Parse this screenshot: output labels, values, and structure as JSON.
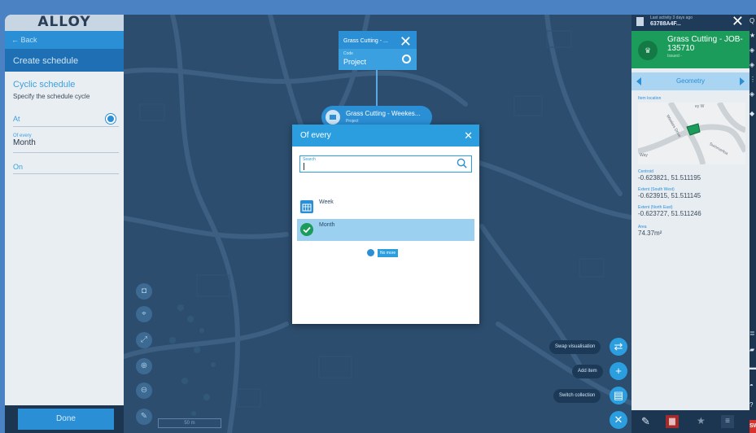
{
  "app": {
    "logo": "ALLOY"
  },
  "left_panel": {
    "back_label": "Back",
    "header": "Create schedule",
    "section_title": "Cyclic schedule",
    "section_subtitle": "Specify the schedule cycle",
    "field_at": "At",
    "field_every_label": "Of every",
    "field_every_value": "Month",
    "field_on": "On",
    "done_label": "Done"
  },
  "nodes": {
    "top_title": "Grass Cutting - ...",
    "top_code_label": "Code",
    "top_code_value": "Project",
    "mid_title": "Grass Cutting - Weekes...",
    "mid_sub": "Project"
  },
  "dialog": {
    "title": "Of every",
    "search_label": "Search",
    "search_value": "",
    "options": [
      {
        "label": "Week",
        "selected": false,
        "icon": "calendar-icon"
      },
      {
        "label": "Month",
        "selected": true,
        "icon": "check-circle-icon"
      }
    ],
    "end_label": "No more"
  },
  "map": {
    "scale_label": "50 m",
    "actions": [
      {
        "label": "Swap visualisation",
        "icon": "swap-icon"
      },
      {
        "label": "Add item",
        "icon": "plus-icon"
      },
      {
        "label": "Switch collection",
        "icon": "collection-icon"
      }
    ]
  },
  "right_panel": {
    "activity": "Last activity 3 days ago",
    "id": "63788A4F...",
    "title": "Grass Cutting - JOB-135710",
    "status": "Issued -",
    "tab_label": "Geometry",
    "item_location_label": "Item location",
    "map_labels": [
      "Weekes Drive",
      "Summerlea",
      "Way",
      "ey W"
    ],
    "centroid_label": "Centroid",
    "centroid": "-0.623821, 51.511195",
    "extent_sw_label": "Extent (South West)",
    "extent_sw": "-0.623915, 51.511145",
    "extent_ne_label": "Extent (North East)",
    "extent_ne": "-0.623727, 51.511246",
    "area_label": "Area",
    "area": "74.37m²"
  },
  "rail": {
    "logo": "SW"
  },
  "colors": {
    "accent": "#2b9ee0",
    "status_green": "#1c9c5a",
    "nav_dark": "#1c3551",
    "danger": "#d9302b"
  }
}
